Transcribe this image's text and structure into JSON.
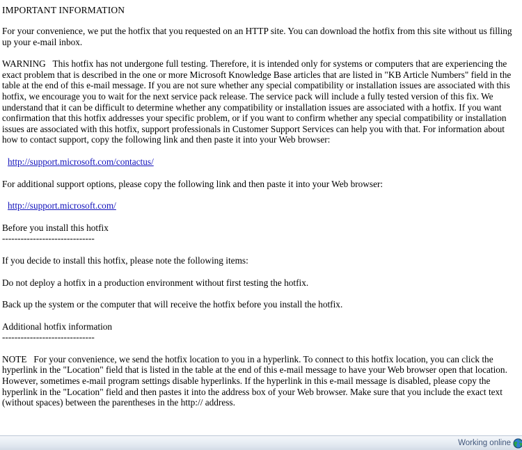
{
  "message": {
    "heading": "IMPORTANT INFORMATION",
    "paragraphs": [
      {
        "id": "intro",
        "text": "For your convenience, we put the hotfix that you requested on an HTTP site. You can download the hotfix from this site without us filling up your e-mail inbox."
      },
      {
        "id": "warning",
        "text": "WARNING   This hotfix has not undergone full testing. Therefore, it is intended only for systems or computers that are experiencing the exact problem that is described in the one or more Microsoft Knowledge Base articles that are listed in \"KB Article Numbers\" field in the table at the end of this e-mail message. If you are not sure whether any special compatibility or installation issues are associated with this hotfix, we encourage you to wait for the next service pack release. The service pack will include a fully tested version of this fix. We understand that it can be difficult to determine whether any compatibility or installation issues are associated with a hotfix. If you want confirmation that this hotfix addresses your specific problem, or if you want to confirm whether any special compatibility or installation issues are associated with this hotfix, support professionals in Customer Support Services can help you with that. For information about how to contact support, copy the following link and then paste it into your Web browser:"
      },
      {
        "id": "additional-options",
        "text": "For additional support options, please copy the following link and then paste it into your Web browser:"
      },
      {
        "id": "before-install-title",
        "text": "Before you install this hotfix"
      },
      {
        "id": "before-install-rule",
        "text": "------------------------------"
      },
      {
        "id": "decide-install",
        "text": "If you decide to install this hotfix, please note the following items:"
      },
      {
        "id": "do-not-deploy",
        "text": "Do not deploy a hotfix in a production environment without first testing the hotfix."
      },
      {
        "id": "back-up",
        "text": "Back up the system or the computer that will receive the hotfix before you install the hotfix."
      },
      {
        "id": "additional-info-title",
        "text": "Additional hotfix information"
      },
      {
        "id": "additional-info-rule",
        "text": "------------------------------"
      },
      {
        "id": "note",
        "text": "NOTE   For your convenience, we send the hotfix location to you in a hyperlink. To connect to this hotfix location, you can click the hyperlink in the \"Location\" field that is listed in the table at the end of this e-mail message to have your Web browser open that location. However, sometimes e-mail program settings disable hyperlinks. If the hyperlink in this e-mail message is disabled, please copy the hyperlink in the \"Location\" field and then pastes it into the address box of your Web browser. Make sure that you include the exact text (without spaces) between the parentheses in the http:// address."
      }
    ],
    "links": [
      {
        "id": "contact-us",
        "text": "http://support.microsoft.com/contactus/",
        "href": "http://support.microsoft.com/contactus/"
      },
      {
        "id": "support-home",
        "text": "http://support.microsoft.com/",
        "href": "http://support.microsoft.com/"
      }
    ]
  },
  "status_bar": {
    "connection_label": "Working online",
    "connection_icon": "globe-icon"
  },
  "colors": {
    "link": "#1111bb",
    "text": "#000000",
    "page_background": "#ffffff",
    "status_text": "#41567a",
    "status_background": "#e6ecf3",
    "status_border": "#bcc7d6"
  }
}
